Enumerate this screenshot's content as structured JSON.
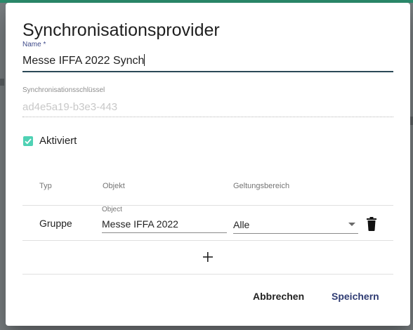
{
  "dialog": {
    "title": "Synchronisationsprovider",
    "name_field": {
      "label": "Name",
      "required_mark": "*",
      "value": "Messe IFFA 2022 Synch"
    },
    "key_field": {
      "label": "Synchronisationsschlüssel",
      "value": "ad4e5a19-b3e3-443"
    },
    "activated": {
      "label": "Aktiviert",
      "checked": true
    },
    "table": {
      "headers": [
        "Typ",
        "Objekt",
        "Geltungsbereich"
      ],
      "rows": [
        {
          "typ": "Gruppe",
          "object_label": "Object",
          "object_value": "Messe IFFA 2022",
          "scope": "Alle"
        }
      ],
      "add_icon": "plus-icon",
      "delete_icon": "trash-icon"
    },
    "buttons": {
      "cancel": "Abbrechen",
      "save": "Speichern"
    },
    "colors": {
      "accent": "#4fd1b4",
      "primary": "#2f3c73",
      "input_underline": "#2b4957"
    }
  }
}
